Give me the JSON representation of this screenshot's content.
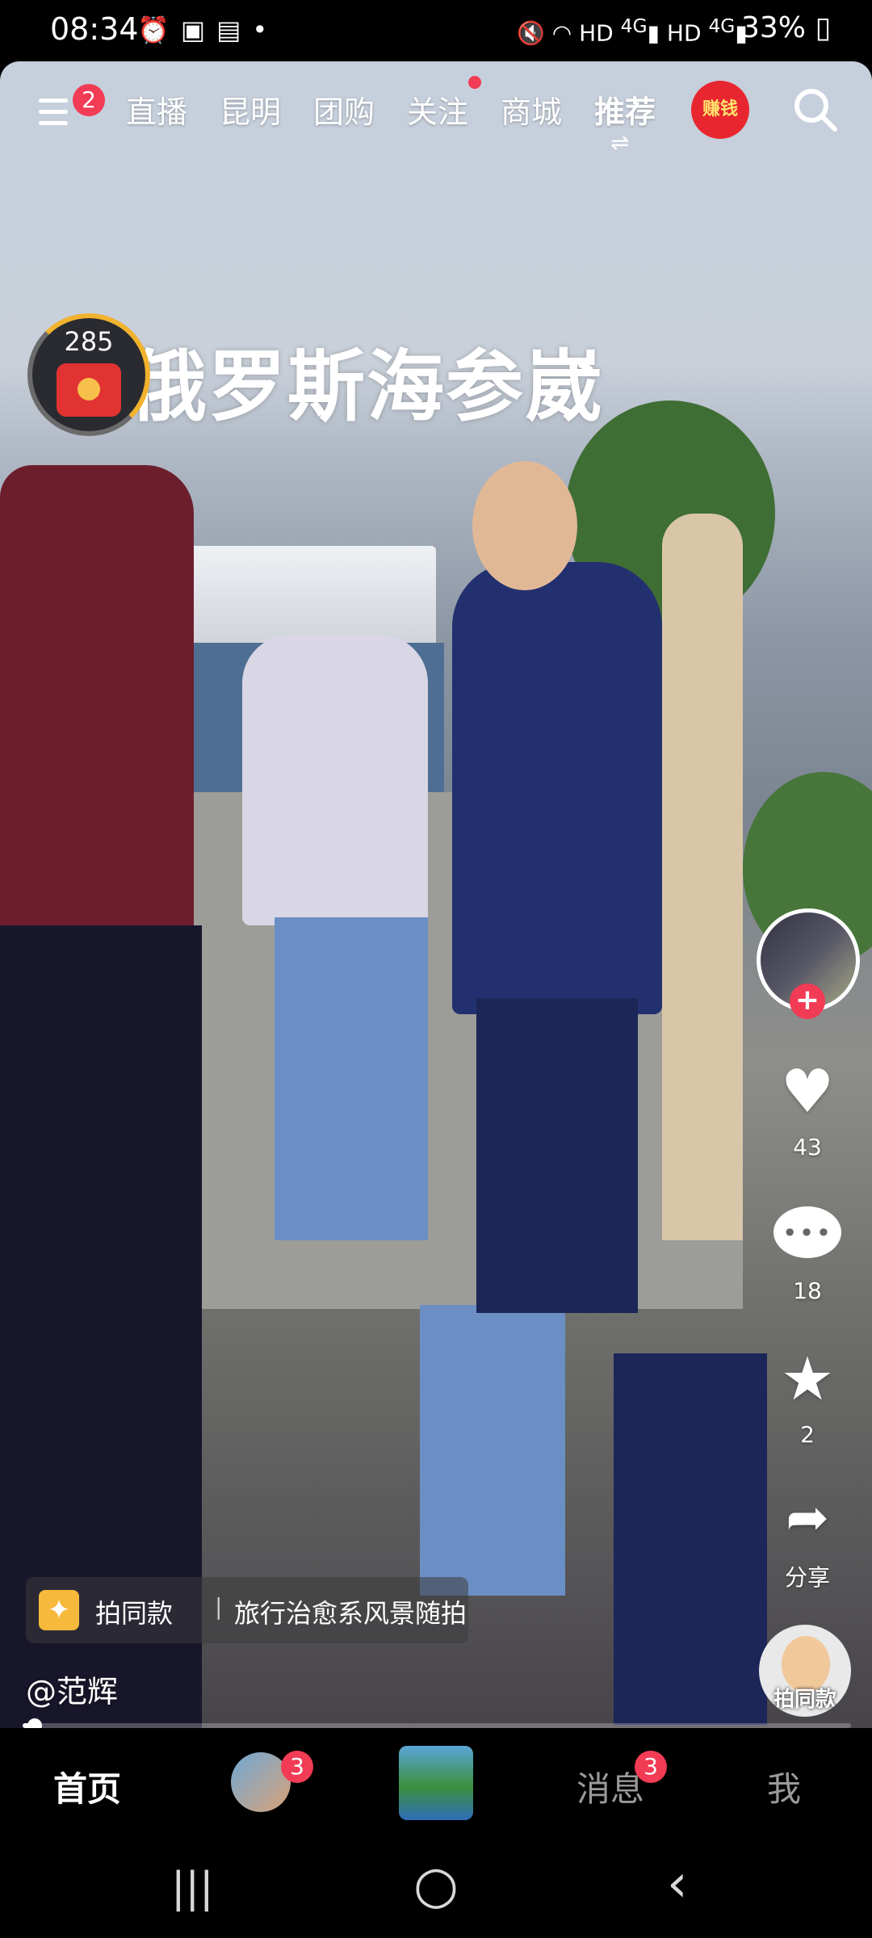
{
  "status_bar": {
    "time": "08:34",
    "left_icons": [
      "alarm-icon",
      "gallery-icon",
      "calendar-icon",
      "dot-icon"
    ],
    "right_icons": [
      "mute-icon",
      "wifi-icon",
      "hd-4g-signal-icon",
      "hd-4g-signal-icon"
    ],
    "hd_label": "HD",
    "net_label": "4G",
    "battery": "33%"
  },
  "top_nav": {
    "menu_badge": "2",
    "tabs": [
      {
        "label": "直播"
      },
      {
        "label": "昆明"
      },
      {
        "label": "团购"
      },
      {
        "label": "关注",
        "dot": true
      },
      {
        "label": "商城"
      },
      {
        "label": "推荐",
        "active": true
      }
    ],
    "swap_glyph": "⇌",
    "earn_label": "赚钱"
  },
  "video": {
    "overlay_title": "俄罗斯海参崴",
    "gift_coin_count": "285"
  },
  "right_rail": {
    "follow_plus": "+",
    "like_count": "43",
    "comment_count": "18",
    "favorite_count": "2",
    "share_label": "分享"
  },
  "bottom_overlay": {
    "same_tag_label": "拍同款",
    "same_tag_separator": "|",
    "same_tag_topic": "旅行治愈系风景随拍",
    "author": "@范辉",
    "same_button_label": "拍同款",
    "progress": 0.01
  },
  "tab_bar": {
    "home": "首页",
    "friends_badge": "3",
    "messages": "消息",
    "messages_badge": "3",
    "me": "我"
  },
  "system_nav": {
    "recent": "|||",
    "home": "○",
    "back": "‹"
  },
  "colors": {
    "accent_red": "#f23b54",
    "background": "#000000"
  }
}
